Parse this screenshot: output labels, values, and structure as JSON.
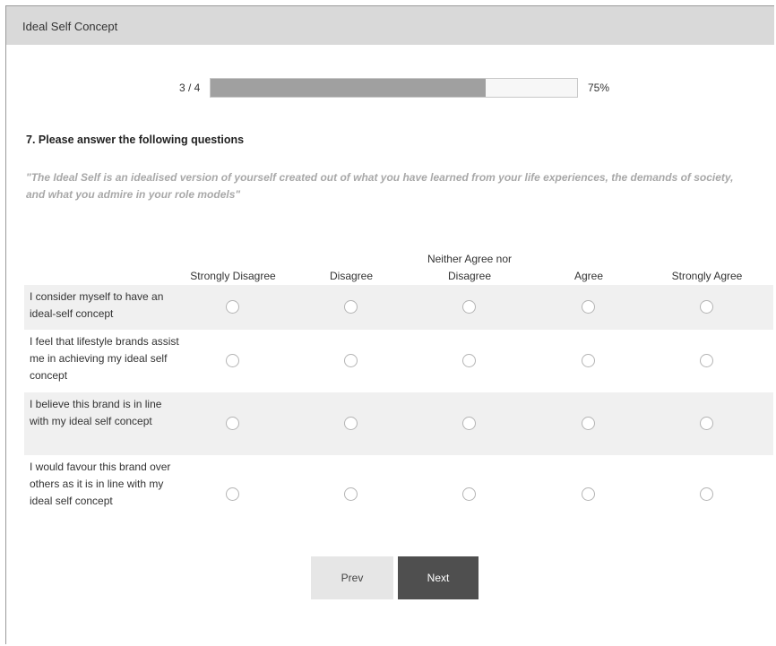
{
  "header": {
    "title": "Ideal Self Concept"
  },
  "progress": {
    "count_label": "3 / 4",
    "percent_label": "75%",
    "fraction": 0.75
  },
  "question": {
    "title": "7. Please answer the following questions",
    "description": "\"The Ideal Self is an idealised version of yourself created out of what you have learned from your life experiences, the demands of society, and what you admire in your role models\""
  },
  "matrix": {
    "columns": [
      {
        "label": "Strongly Disagree"
      },
      {
        "label": "Disagree"
      },
      {
        "label": "Neither Agree nor Disagree"
      },
      {
        "label": "Agree"
      },
      {
        "label": "Strongly Agree"
      }
    ],
    "rows": [
      {
        "label": "I consider myself to have an ideal-self concept"
      },
      {
        "label": "I feel that lifestyle brands assist me in achieving my ideal self concept"
      },
      {
        "label": "I believe this brand is in line with my ideal self concept"
      },
      {
        "label": "I would favour this brand over others as it is in line with my ideal self concept"
      }
    ]
  },
  "nav": {
    "prev_label": "Prev",
    "next_label": "Next"
  }
}
